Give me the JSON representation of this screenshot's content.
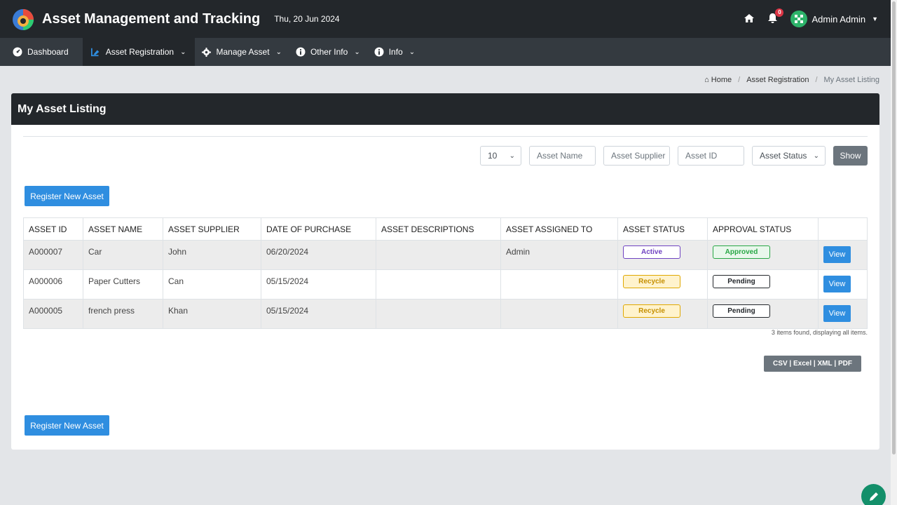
{
  "header": {
    "app_title": "Asset Management and Tracking",
    "date": "Thu, 20 Jun 2024",
    "notification_count": "0",
    "user_name": "Admin Admin"
  },
  "nav": {
    "items": [
      {
        "label": "Dashboard",
        "icon": "dashboard-icon"
      },
      {
        "label": "Asset Registration",
        "icon": "asset-registration-icon"
      },
      {
        "label": "Manage Asset",
        "icon": "gear-icon"
      },
      {
        "label": "Other Info",
        "icon": "info-icon"
      },
      {
        "label": "Info",
        "icon": "info-icon"
      }
    ]
  },
  "breadcrumb": {
    "home": "Home",
    "section": "Asset Registration",
    "current": "My Asset Listing"
  },
  "page": {
    "title": "My Asset Listing",
    "register_button": "Register New Asset",
    "items_found": "3 items found, displaying all items."
  },
  "filters": {
    "page_size": "10",
    "asset_name_placeholder": "Asset Name",
    "asset_supplier_placeholder": "Asset Supplier",
    "asset_id_placeholder": "Asset ID",
    "asset_status_placeholder": "Asset Status",
    "show_button": "Show"
  },
  "table": {
    "columns": [
      "ASSET ID",
      "ASSET NAME",
      "ASSET SUPPLIER",
      "DATE OF PURCHASE",
      "ASSET DESCRIPTIONS",
      "ASSET ASSIGNED TO",
      "ASSET STATUS",
      "APPROVAL STATUS",
      ""
    ],
    "rows": [
      {
        "id": "A000007",
        "name": "Car",
        "supplier": "John",
        "date": "06/20/2024",
        "description": "",
        "assigned": "Admin",
        "status": "Active",
        "approval": "Approved",
        "action": "View"
      },
      {
        "id": "A000006",
        "name": "Paper Cutters",
        "supplier": "Can",
        "date": "05/15/2024",
        "description": "",
        "assigned": "",
        "status": "Recycle",
        "approval": "Pending",
        "action": "View"
      },
      {
        "id": "A000005",
        "name": "french press",
        "supplier": "Khan",
        "date": "05/15/2024",
        "description": "",
        "assigned": "",
        "status": "Recycle",
        "approval": "Pending",
        "action": "View"
      }
    ]
  },
  "export": {
    "csv": "CSV",
    "excel": "Excel",
    "xml": "XML",
    "pdf": "PDF"
  },
  "colors": {
    "topbar": "#23272b",
    "navbar": "#343a40",
    "primary": "#2f8ee0",
    "active_badge": "#6f42c1",
    "recycle_badge": "#e0a800",
    "approved_badge": "#28a745",
    "fab": "#138f6a"
  }
}
